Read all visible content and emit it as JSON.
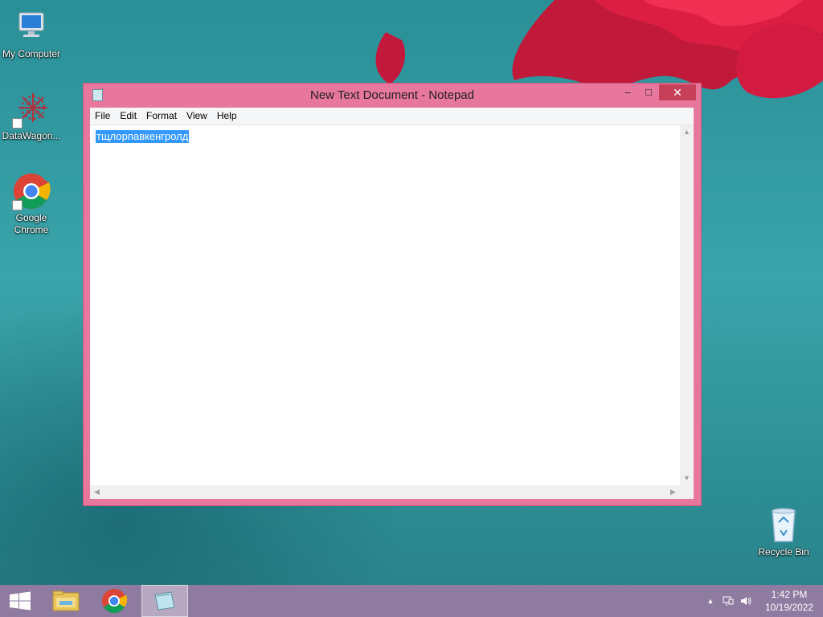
{
  "desktop": {
    "icons": [
      {
        "label": "My Computer",
        "icon": "computer-icon"
      },
      {
        "label": "DataWagon...",
        "icon": "datawagon-icon"
      },
      {
        "label": "Google Chrome",
        "icon": "chrome-icon"
      },
      {
        "label": "Recycle Bin",
        "icon": "recycle-bin-icon"
      }
    ]
  },
  "window": {
    "title": "New Text Document - Notepad",
    "app_icon": "notepad-icon",
    "controls": {
      "minimize": "–",
      "maximize": "□",
      "close": "✕"
    },
    "menu": [
      "File",
      "Edit",
      "Format",
      "View",
      "Help"
    ],
    "content": "тщлорпавкенгролд",
    "content_selected": true
  },
  "taskbar": {
    "items": [
      {
        "name": "start",
        "icon": "windows-logo-icon"
      },
      {
        "name": "file-explorer",
        "icon": "folder-icon"
      },
      {
        "name": "chrome",
        "icon": "chrome-icon"
      },
      {
        "name": "notepad",
        "icon": "notepad-icon",
        "active": true
      }
    ],
    "tray": {
      "chevron": "▲",
      "time": "1:42 PM",
      "date": "10/19/2022"
    }
  },
  "colors": {
    "window_frame": "#e8779e",
    "close_button": "#c7405a",
    "selection": "#3399ff",
    "taskbar": "#8f7aa0"
  }
}
